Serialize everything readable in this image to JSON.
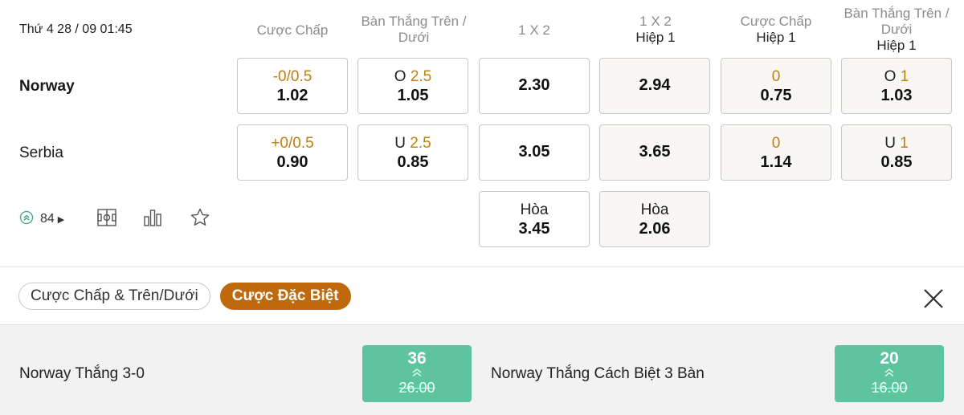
{
  "match": {
    "datetime": "Thứ 4 28 / 09 01:45",
    "home": "Norway",
    "away": "Serbia",
    "draw_label": "Hòa"
  },
  "columns": [
    {
      "title": "Cược Chấp",
      "sub": ""
    },
    {
      "title": "Bàn Thắng Trên / Dưới",
      "sub": ""
    },
    {
      "title": "1 X 2",
      "sub": ""
    },
    {
      "title": "1 X 2",
      "sub": "Hiệp 1"
    },
    {
      "title": "Cược Chấp",
      "sub": "Hiệp 1"
    },
    {
      "title": "Bàn Thắng Trên / Dưới",
      "sub": "Hiệp 1"
    }
  ],
  "odds": {
    "home": {
      "handicap": {
        "line": "-0/0.5",
        "odd": "1.02"
      },
      "ou": {
        "side": "O",
        "line": "2.5",
        "odd": "1.05"
      },
      "x12": "2.30",
      "x12_h1": "2.94",
      "handicap_h1": {
        "line": "0",
        "odd": "0.75"
      },
      "ou_h1": {
        "side": "O",
        "line": "1",
        "odd": "1.03"
      }
    },
    "away": {
      "handicap": {
        "line": "+0/0.5",
        "odd": "0.90"
      },
      "ou": {
        "side": "U",
        "line": "2.5",
        "odd": "0.85"
      },
      "x12": "3.05",
      "x12_h1": "3.65",
      "handicap_h1": {
        "line": "0",
        "odd": "1.14"
      },
      "ou_h1": {
        "side": "U",
        "line": "1",
        "odd": "0.85"
      }
    },
    "draw": {
      "x12": "3.45",
      "x12_h1": "2.06"
    }
  },
  "toolbar": {
    "more_count": "84",
    "icons": [
      "chevrons-up-circle-icon",
      "field-icon",
      "bar-chart-icon",
      "star-icon"
    ]
  },
  "tabs": [
    {
      "label": "Cược Chấp & Trên/Dưới",
      "active": false
    },
    {
      "label": "Cược Đặc Biệt",
      "active": true
    }
  ],
  "specials": [
    {
      "label": "Norway Thắng 3-0",
      "value": "36",
      "old_value": "26.00"
    },
    {
      "label": "Norway Thắng Cách Biệt 3 Bàn",
      "value": "20",
      "old_value": "16.00"
    }
  ],
  "colors": {
    "accent": "#c0690c",
    "highlight": "#c07d12",
    "boost": "#5ec4a0"
  }
}
